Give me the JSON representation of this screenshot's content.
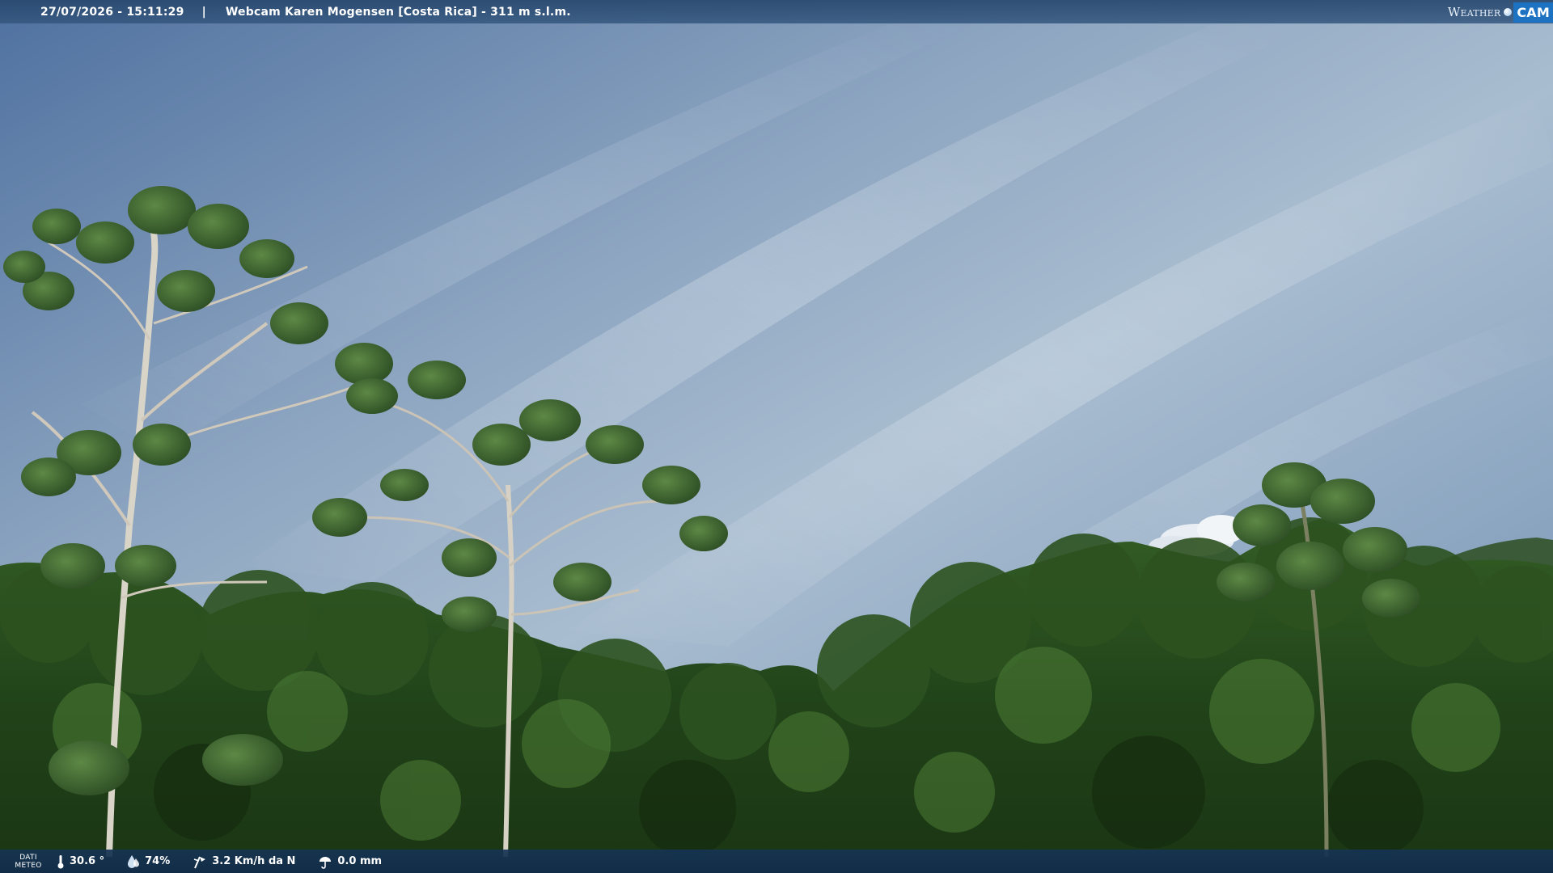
{
  "window": {
    "datetime": "27/07/2026 - 15:11:29",
    "separator": "|",
    "camera_title": "Webcam Karen Mogensen [Costa Rica] - 311 m s.l.m."
  },
  "logo": {
    "weather_text": "Weather",
    "cam_text": "CAM",
    "icon": "globe-dot-icon"
  },
  "weather_bar": {
    "dati_line1": "DATI",
    "dati_line2": "METEO",
    "temperature": "30.6 °",
    "humidity": "74%",
    "wind": "3.2 Km/h da N",
    "rain": "0.0 mm",
    "icons": [
      "thermometer-icon",
      "humidity-drop-icon",
      "wind-icon",
      "rain-icon"
    ]
  },
  "colors": {
    "top_bar": "#2f5682",
    "bottom_bar": "#16385c",
    "logo_accent": "#1d73c2",
    "sky_top": "#5f82ad",
    "sky_light": "#b2c5d6",
    "foliage_dark": "#16300f",
    "foliage_light": "#4f7a38"
  }
}
